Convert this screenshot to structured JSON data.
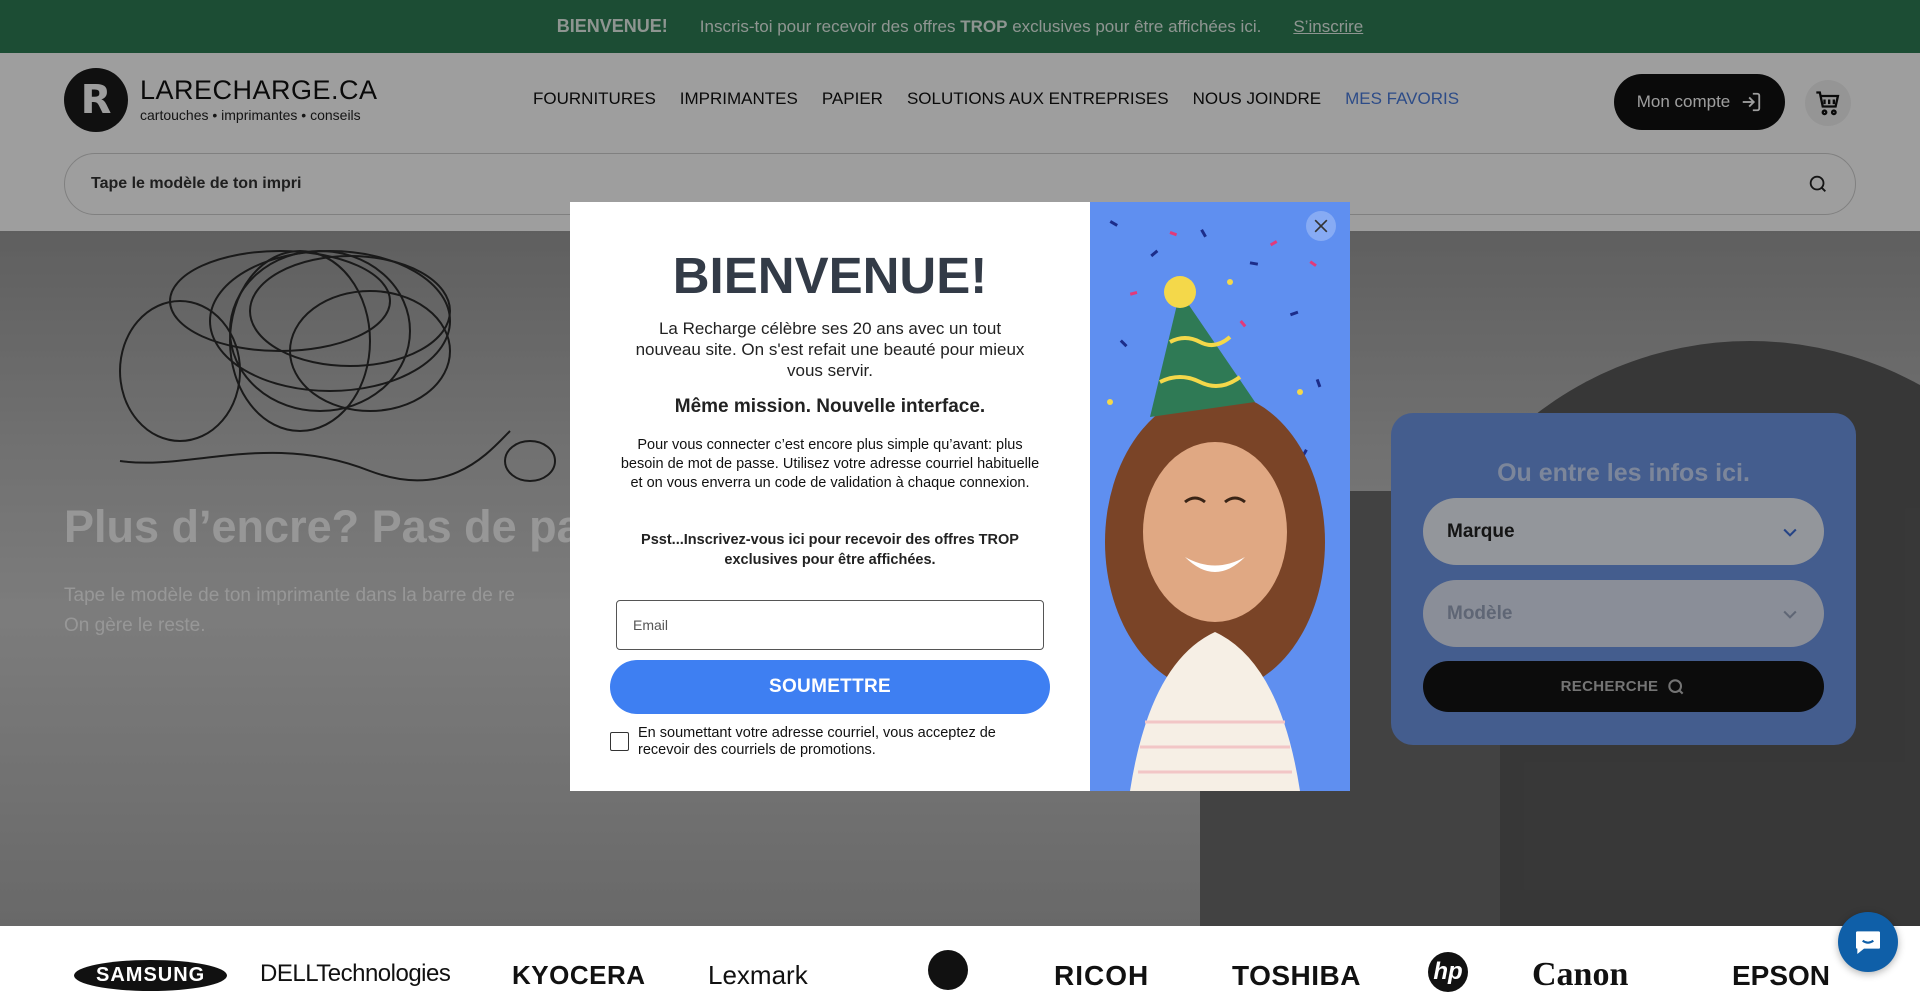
{
  "announcement": {
    "welcome": "BIENVENUE!",
    "text_before": "Inscris-toi pour recevoir des offres ",
    "text_bold": "TROP",
    "text_after": " exclusives pour être affichées ici.",
    "link": "S’inscrire"
  },
  "header": {
    "logo_title": "LARECHARGE.CA",
    "logo_tagline": "cartouches • imprimantes • conseils",
    "nav": [
      "FOURNITURES",
      "IMPRIMANTES",
      "PAPIER",
      "SOLUTIONS AUX ENTREPRISES",
      "NOUS JOINDRE",
      "MES FAVORIS"
    ],
    "account_label": "Mon compte",
    "search_placeholder": "Tape le modèle de ton impri"
  },
  "hero": {
    "title": "Plus d’encre? Pas de pa",
    "subtitle_line1": "Tape le modèle de ton imprimante dans la barre de re",
    "subtitle_line2": "On gère le reste."
  },
  "finder": {
    "title": "Ou entre les infos ici.",
    "brand_label": "Marque",
    "model_label": "Modèle",
    "search_label": "RECHERCHE"
  },
  "modal": {
    "title": "BIENVENUE!",
    "intro": "La Recharge célèbre ses 20 ans avec un tout nouveau site. On s'est refait une beauté pour mieux vous servir.",
    "headline": "Même mission. Nouvelle interface.",
    "body": "Pour vous connecter c’est encore plus simple qu’avant: plus besoin de mot de passe. Utilisez votre adresse courriel habituelle et on vous enverra un code de validation à chaque connexion.",
    "promo": "Psst...Inscrivez-vous ici pour recevoir des offres TROP exclusives pour être affichées.",
    "email_placeholder": "Email",
    "submit_label": "SOUMETTRE",
    "consent": "En soumettant votre adresse courriel, vous acceptez de recevoir des courriels de promotions."
  },
  "brands": [
    "SAMSUNG",
    "DELLTechnologies",
    "KYOCERA",
    "Lexmark",
    "RICOH",
    "TOSHIBA",
    "hp",
    "Canon",
    "EPSON"
  ],
  "colors": {
    "announcement_bg": "#2e7d55",
    "accent_blue": "#3e7ff2",
    "favorites_blue": "#4a7bdb",
    "finder_bg": "#6f96e6"
  }
}
